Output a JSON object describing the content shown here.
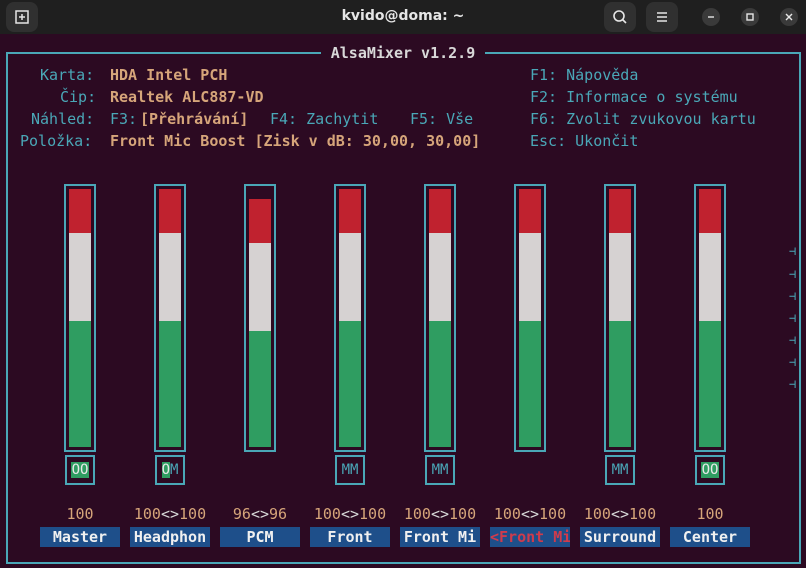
{
  "window": {
    "title": "kvido@doma: ~"
  },
  "app": {
    "title": "AlsaMixer v1.2.9"
  },
  "info": {
    "card_label": "Karta:",
    "card_value": "HDA Intel PCH",
    "chip_label": "Čip:",
    "chip_value": "Realtek ALC887-VD",
    "view_label": "Náhled:",
    "view_f3": "F3:",
    "view_f3_value": "[Přehrávání]",
    "view_f4": "F4: Zachytit",
    "view_f5": "F5: Vše",
    "item_label": "Položka:",
    "item_value": "Front Mic Boost [Zisk v dB: 30,00, 30,00]"
  },
  "help": {
    "f1": "F1: Nápověda",
    "f2": "F2: Informace o systému",
    "f6": "F6: Zvolit zvukovou kartu",
    "esc": "Esc: Ukončit"
  },
  "channels": [
    {
      "name": "Master",
      "volume": "100",
      "switch": "OO",
      "level": 100,
      "selected": false
    },
    {
      "name": "Headphon",
      "volume": "100<>100",
      "switch": "OM",
      "level": 100,
      "selected": false
    },
    {
      "name": "PCM",
      "volume": "96<>96",
      "switch": "",
      "level": 96,
      "selected": false
    },
    {
      "name": "Front",
      "volume": "100<>100",
      "switch": "MM",
      "level": 100,
      "selected": false
    },
    {
      "name": "Front Mi",
      "volume": "100<>100",
      "switch": "MM",
      "level": 100,
      "selected": false
    },
    {
      "name": "<Front Mi>",
      "volume": "100<>100",
      "switch": "",
      "level": 100,
      "selected": true
    },
    {
      "name": "Surround",
      "volume": "100<>100",
      "switch": "MM",
      "level": 100,
      "selected": false
    },
    {
      "name": "Center",
      "volume": "100",
      "switch": "OO",
      "level": 100,
      "selected": false
    }
  ],
  "colors": {
    "red": "#c0222f",
    "white": "#d6d2d2",
    "green": "#2f9d61",
    "frame": "#4aa7b7",
    "bg": "#2c0a22"
  }
}
